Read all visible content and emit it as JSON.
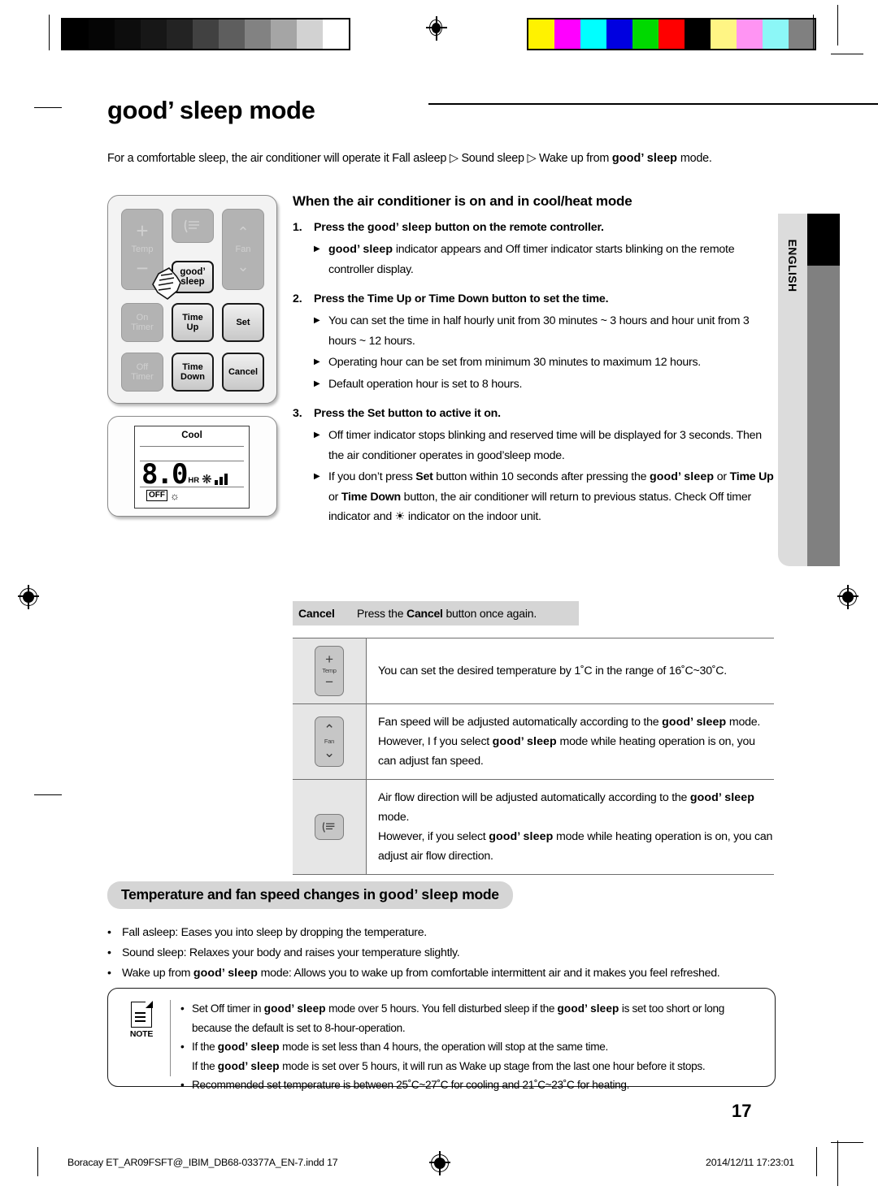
{
  "document": {
    "page_title": "good’ sleep mode",
    "page_number": "17",
    "language_tab": "ENGLISH",
    "intro": {
      "before": "For a comfortable sleep, the air conditioner will operate it Fall asleep ▷ Sound sleep ▷ Wake up from ",
      "brand": "good’ sleep",
      "after": " mode."
    }
  },
  "calibration": {
    "grayscale": [
      "#000000",
      "#050505",
      "#0d0d0d",
      "#171717",
      "#232323",
      "#414141",
      "#5e5e5e",
      "#828282",
      "#a5a5a5",
      "#d2d2d2",
      "#ffffff"
    ],
    "colors": [
      "#fff200",
      "#ff00ff",
      "#00ffff",
      "#0000e0",
      "#00d900",
      "#ff0000",
      "#000000",
      "#fff584",
      "#ff94f3",
      "#8cf7f7",
      "#808080"
    ]
  },
  "remote": {
    "buttons": {
      "temp": "Temp",
      "plus": "+",
      "minus": "−",
      "swing": "swing-icon",
      "fan": "Fan",
      "good_sleep_line1": "good’",
      "good_sleep_line2": "sleep",
      "on_timer_line1": "On",
      "on_timer_line2": "Timer",
      "time_up_line1": "Time",
      "time_up_line2": "Up",
      "set": "Set",
      "off_timer_line1": "Off",
      "off_timer_line2": "Timer",
      "time_down_line1": "Time",
      "time_down_line2": "Down",
      "cancel": "Cancel"
    }
  },
  "lcd": {
    "mode": "Cool",
    "value": "8.0",
    "unit": "HR",
    "fan_icon": "fan-icon",
    "fan_bars": 3,
    "off_label": "OFF",
    "sleep_icon": "good-sleep-icon"
  },
  "main": {
    "subheading": "When the air conditioner is on and in cool/heat mode",
    "steps": [
      {
        "num": "1.",
        "text_parts": [
          {
            "t": "Press the ",
            "b": false
          },
          {
            "t": "good’ sleep",
            "b": true,
            "brand": true
          },
          {
            "t": " button on the remote controller.",
            "b": false
          }
        ],
        "bullets": [
          [
            {
              "t": "good’ sleep",
              "b": true,
              "brand": true
            },
            {
              "t": " indicator appears and Off timer indicator starts blinking on the remote controller display.",
              "b": false
            }
          ]
        ]
      },
      {
        "num": "2.",
        "text_parts": [
          {
            "t": "Press the ",
            "b": false
          },
          {
            "t": "Time Up",
            "b": true
          },
          {
            "t": " or ",
            "b": false
          },
          {
            "t": "Time Down",
            "b": true
          },
          {
            "t": " button to set the time.",
            "b": false
          }
        ],
        "bullets": [
          [
            {
              "t": "You can set the time in half hourly unit from 30 minutes ~ 3 hours and hour unit from 3 hours ~ 12 hours.",
              "b": false
            }
          ],
          [
            {
              "t": "Operating hour can be set from minimum 30 minutes to maximum 12 hours.",
              "b": false
            }
          ],
          [
            {
              "t": "Default operation hour is set to 8 hours.",
              "b": false
            }
          ]
        ]
      },
      {
        "num": "3.",
        "text_parts": [
          {
            "t": "Press the ",
            "b": false
          },
          {
            "t": "Set",
            "b": true
          },
          {
            "t": " button to active it on.",
            "b": false
          }
        ],
        "bullets": [
          [
            {
              "t": "Off timer indicator stops blinking and reserved time will be displayed for 3 seconds. Then the air conditioner operates in good’sleep mode.",
              "b": false
            }
          ],
          [
            {
              "t": "If you don’t press ",
              "b": false
            },
            {
              "t": "Set",
              "b": true
            },
            {
              "t": " button within 10 seconds after pressing the ",
              "b": false
            },
            {
              "t": "good’ sleep",
              "b": true,
              "brand": true
            },
            {
              "t": " or ",
              "b": false
            },
            {
              "t": "Time Up",
              "b": true
            },
            {
              "t": " or ",
              "b": false
            },
            {
              "t": "Time Down",
              "b": true
            },
            {
              "t": " button, the air conditioner will return to previous status. Check Off timer indicator and ☀ indicator on the indoor unit.",
              "b": false
            }
          ]
        ]
      }
    ],
    "cancel_row": {
      "label": "Cancel",
      "text_parts": [
        {
          "t": "Press the ",
          "b": false
        },
        {
          "t": "Cancel",
          "b": true
        },
        {
          "t": " button once again.",
          "b": false
        }
      ]
    },
    "function_table": [
      {
        "icon": "temp-button-icon",
        "icon_label": "Temp",
        "lines": [
          [
            {
              "t": "You can set the desired temperature by 1˚C in the range of 16˚C~30˚C.",
              "b": false
            }
          ]
        ]
      },
      {
        "icon": "fan-button-icon",
        "icon_label": "Fan",
        "lines": [
          [
            {
              "t": "Fan speed will be adjusted automatically according to the ",
              "b": false
            },
            {
              "t": "good’ sleep",
              "b": true,
              "brand": true
            },
            {
              "t": " mode.",
              "b": false
            }
          ],
          [
            {
              "t": "However, I f you select ",
              "b": false
            },
            {
              "t": "good’ sleep",
              "b": true,
              "brand": true
            },
            {
              "t": " mode while heating operation is on, you can adjust fan speed.",
              "b": false
            }
          ]
        ]
      },
      {
        "icon": "swing-button-icon",
        "icon_label": "",
        "lines": [
          [
            {
              "t": "Air flow direction will be adjusted automatically according to the ",
              "b": false
            },
            {
              "t": "good’ sleep",
              "b": true,
              "brand": true
            },
            {
              "t": " mode.",
              "b": false
            }
          ],
          [
            {
              "t": "However, if you select ",
              "b": false
            },
            {
              "t": "good’ sleep",
              "b": true,
              "brand": true
            },
            {
              "t": " mode while heating operation is on, you can adjust air flow direction.",
              "b": false
            }
          ]
        ]
      }
    ]
  },
  "section": {
    "pill_parts": [
      {
        "t": "Temperature and fan speed changes in ",
        "b": true
      },
      {
        "t": "good’ sleep",
        "b": true,
        "brand": true
      },
      {
        "t": " mode",
        "b": true
      }
    ],
    "features": [
      [
        {
          "t": "Fall asleep: Eases you into sleep by dropping the temperature.",
          "b": false
        }
      ],
      [
        {
          "t": "Sound sleep: Relaxes your body and raises your temperature slightly.",
          "b": false
        }
      ],
      [
        {
          "t": "Wake up from ",
          "b": false
        },
        {
          "t": "good’ sleep",
          "b": true,
          "brand": true
        },
        {
          "t": " mode: Allows you to wake up from comfortable intermittent air and it makes you feel refreshed.",
          "b": false
        }
      ]
    ]
  },
  "note": {
    "label": "NOTE",
    "items": [
      [
        {
          "t": "Set Off timer in ",
          "b": false
        },
        {
          "t": "good’ sleep",
          "b": true,
          "brand": true
        },
        {
          "t": " mode over 5 hours. You fell disturbed sleep if the ",
          "b": false
        },
        {
          "t": "good’ sleep",
          "b": true,
          "brand": true
        },
        {
          "t": " is set too short or long because the default is set to 8-hour-operation.",
          "b": false
        }
      ],
      [
        {
          "t": "If the ",
          "b": false
        },
        {
          "t": "good’ sleep",
          "b": true,
          "brand": true
        },
        {
          "t": " mode is set less than 4 hours, the operation will stop at the same time.",
          "b": false
        },
        {
          "t": "\nIf the ",
          "b": false
        },
        {
          "t": "good’ sleep",
          "b": true,
          "brand": true
        },
        {
          "t": " mode is set over 5 hours, it will run as Wake up stage from the last one hour before it stops.",
          "b": false
        }
      ],
      [
        {
          "t": "Recommended set temperature is between 25˚C~27˚C for cooling and 21˚C~23˚C for heating.",
          "b": false
        }
      ]
    ]
  },
  "footer": {
    "file_info": "Boracay ET_AR09FSFT@_IBIM_DB68-03377A_EN-7.indd   17",
    "timestamp": "2014/12/11   17:23:01"
  }
}
